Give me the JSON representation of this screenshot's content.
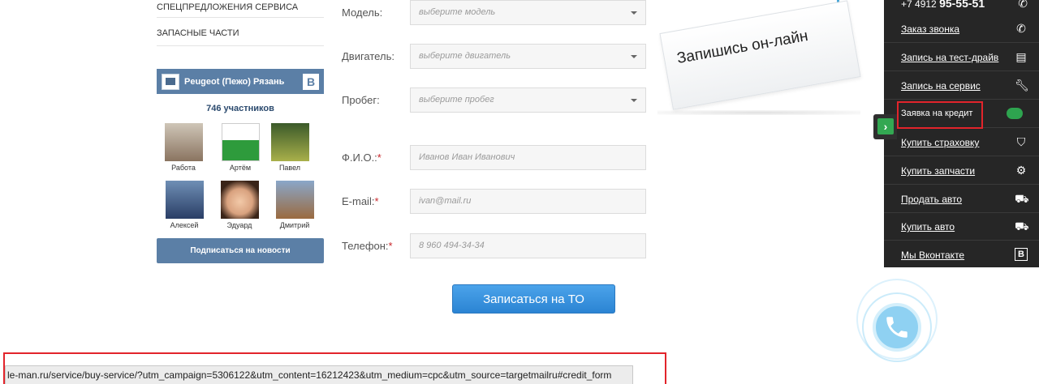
{
  "left_menu": {
    "items": [
      {
        "label": "СПЕЦПРЕДЛОЖЕНИЯ СЕРВИСА"
      },
      {
        "label": "ЗАПАСНЫЕ ЧАСТИ"
      }
    ]
  },
  "vk_widget": {
    "title": "Peugeot (Пежо) Рязань",
    "vk_letter": "В",
    "members_count": "746 участников",
    "members": [
      {
        "name": "Работа"
      },
      {
        "name": "Артём"
      },
      {
        "name": "Павел"
      },
      {
        "name": "Алексей"
      },
      {
        "name": "Эдуард"
      },
      {
        "name": "Дмитрий"
      }
    ],
    "subscribe_label": "Подписаться на новости"
  },
  "form": {
    "fields": [
      {
        "label": "Модель:",
        "required": "",
        "placeholder": "выберите модель"
      },
      {
        "label": "Двигатель:",
        "required": "",
        "placeholder": "выберите двигатель"
      },
      {
        "label": "Пробег:",
        "required": "",
        "placeholder": "выберите пробег"
      },
      {
        "label": "Ф.И.О.:",
        "required": "*",
        "placeholder": "Иванов Иван Иванович"
      },
      {
        "label": "E-mail:",
        "required": "*",
        "placeholder": "ivan@mail.ru"
      },
      {
        "label": "Телефон:",
        "required": "*",
        "placeholder": "8 960 494-34-34"
      }
    ],
    "submit_label": "Записаться на ТО"
  },
  "tag": {
    "text": "Запишись он-лайн"
  },
  "right_panel": {
    "phone_prefix": "+7 4912",
    "phone_number": "95-55-51",
    "items": [
      {
        "label": "Заказ звонка",
        "icon": "phone-icon"
      },
      {
        "label": "Запись на тест-драйв",
        "icon": "document-icon"
      },
      {
        "label": "Запись на сервис",
        "icon": "wrench-icon"
      },
      {
        "label": "Заявка на кредит",
        "icon": "piggy-bank-icon"
      },
      {
        "label": "Купить страховку",
        "icon": "shield-icon"
      },
      {
        "label": "Купить запчасти",
        "icon": "gear-icon"
      },
      {
        "label": "Продать авто",
        "icon": "car-icon"
      },
      {
        "label": "Купить авто",
        "icon": "car-icon"
      },
      {
        "label": "Мы Вконтакте",
        "icon": "vk-icon"
      }
    ],
    "highlight_color": "#e2242b",
    "accent_green": "#33a852"
  },
  "status_bar": {
    "url": "le-man.ru/service/buy-service/?utm_campaign=5306122&utm_content=16212423&utm_medium=cpc&utm_source=targetmailru#credit_form"
  }
}
